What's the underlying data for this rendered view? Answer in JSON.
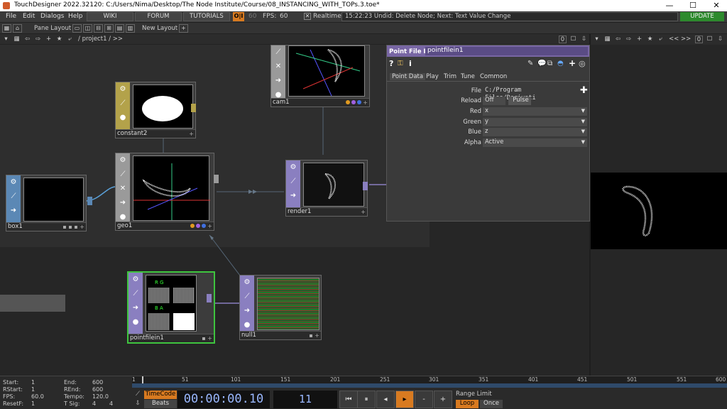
{
  "window": {
    "title": "TouchDesigner 2022.32120: C:/Users/Nima/Desktop/The Node Institute/Course/08_INSTANCING_WITH_TOPs.3.toe*",
    "minimize": "—",
    "maximize": "☐",
    "close": "✕"
  },
  "menubar": {
    "items": [
      "File",
      "Edit",
      "Dialogs",
      "Help"
    ],
    "wiki": "WIKI",
    "forum": "FORUM",
    "tutorials": "TUTORIALS",
    "perf_label": "O|I",
    "fps_target": "60",
    "fps_label": "FPS:",
    "fps_value": "60",
    "realtime_label": "Realtime",
    "realtime_check": "✕",
    "status": "15:22:23 Undid: Delete Node; Next: Text Value Change",
    "update": "UPDATE"
  },
  "panebar": {
    "pane_layout": "Pane Layout",
    "new_layout": "New Layout",
    "plus": "+"
  },
  "pathbar": {
    "path": "/ project1 / >>",
    "zero": "0",
    "zero2": "0",
    "nav": "<< >>"
  },
  "nodes": {
    "box1": "box1",
    "constant2": "constant2",
    "geo1": "geo1",
    "cam1": "cam1",
    "render1": "render1",
    "pointfilein1": "pointfilein1",
    "null1": "null1"
  },
  "param": {
    "op_type": "Point File In",
    "op_name": "pointfilein1",
    "tabs": [
      "Point Data",
      "Play",
      "Trim",
      "Tune",
      "Common"
    ],
    "file_label": "File",
    "file_value": "C:/Program Files/Derivati",
    "reload_label": "Reload",
    "reload_value": "Off",
    "pulse": "Pulse",
    "red_label": "Red",
    "red_value": "x",
    "green_label": "Green",
    "green_value": "y",
    "blue_label": "Blue",
    "blue_value": "z",
    "alpha_label": "Alpha",
    "alpha_value": "Active"
  },
  "timeline": {
    "start_label": "Start:",
    "start_value": "1",
    "end_label": "End:",
    "end_value": "600",
    "rstart_label": "RStart:",
    "rstart_value": "1",
    "rend_label": "REnd:",
    "rend_value": "600",
    "fps_label": "FPS:",
    "fps_value": "60.0",
    "tempo_label": "Tempo:",
    "tempo_value": "120.0",
    "resetf_label": "ResetF:",
    "resetf_value": "1",
    "tsig_label": "T Sig:",
    "tsig_a": "4",
    "tsig_b": "4",
    "ticks": [
      "1",
      "51",
      "101",
      "151",
      "201",
      "251",
      "301",
      "351",
      "401",
      "451",
      "501",
      "551",
      "600"
    ],
    "timecode_btn": "TimeCode",
    "beats_btn": "Beats",
    "timecode": "00:00:00.10",
    "frame": "11",
    "range_limit": "Range Limit",
    "loop": "Loop",
    "once": "Once"
  },
  "colors": {
    "sop": "#5b88b5",
    "top": "#8a7fc0",
    "comp": "#9a9a9a",
    "chop_constant": "#b3a24a",
    "select_green": "#3ec43e"
  }
}
